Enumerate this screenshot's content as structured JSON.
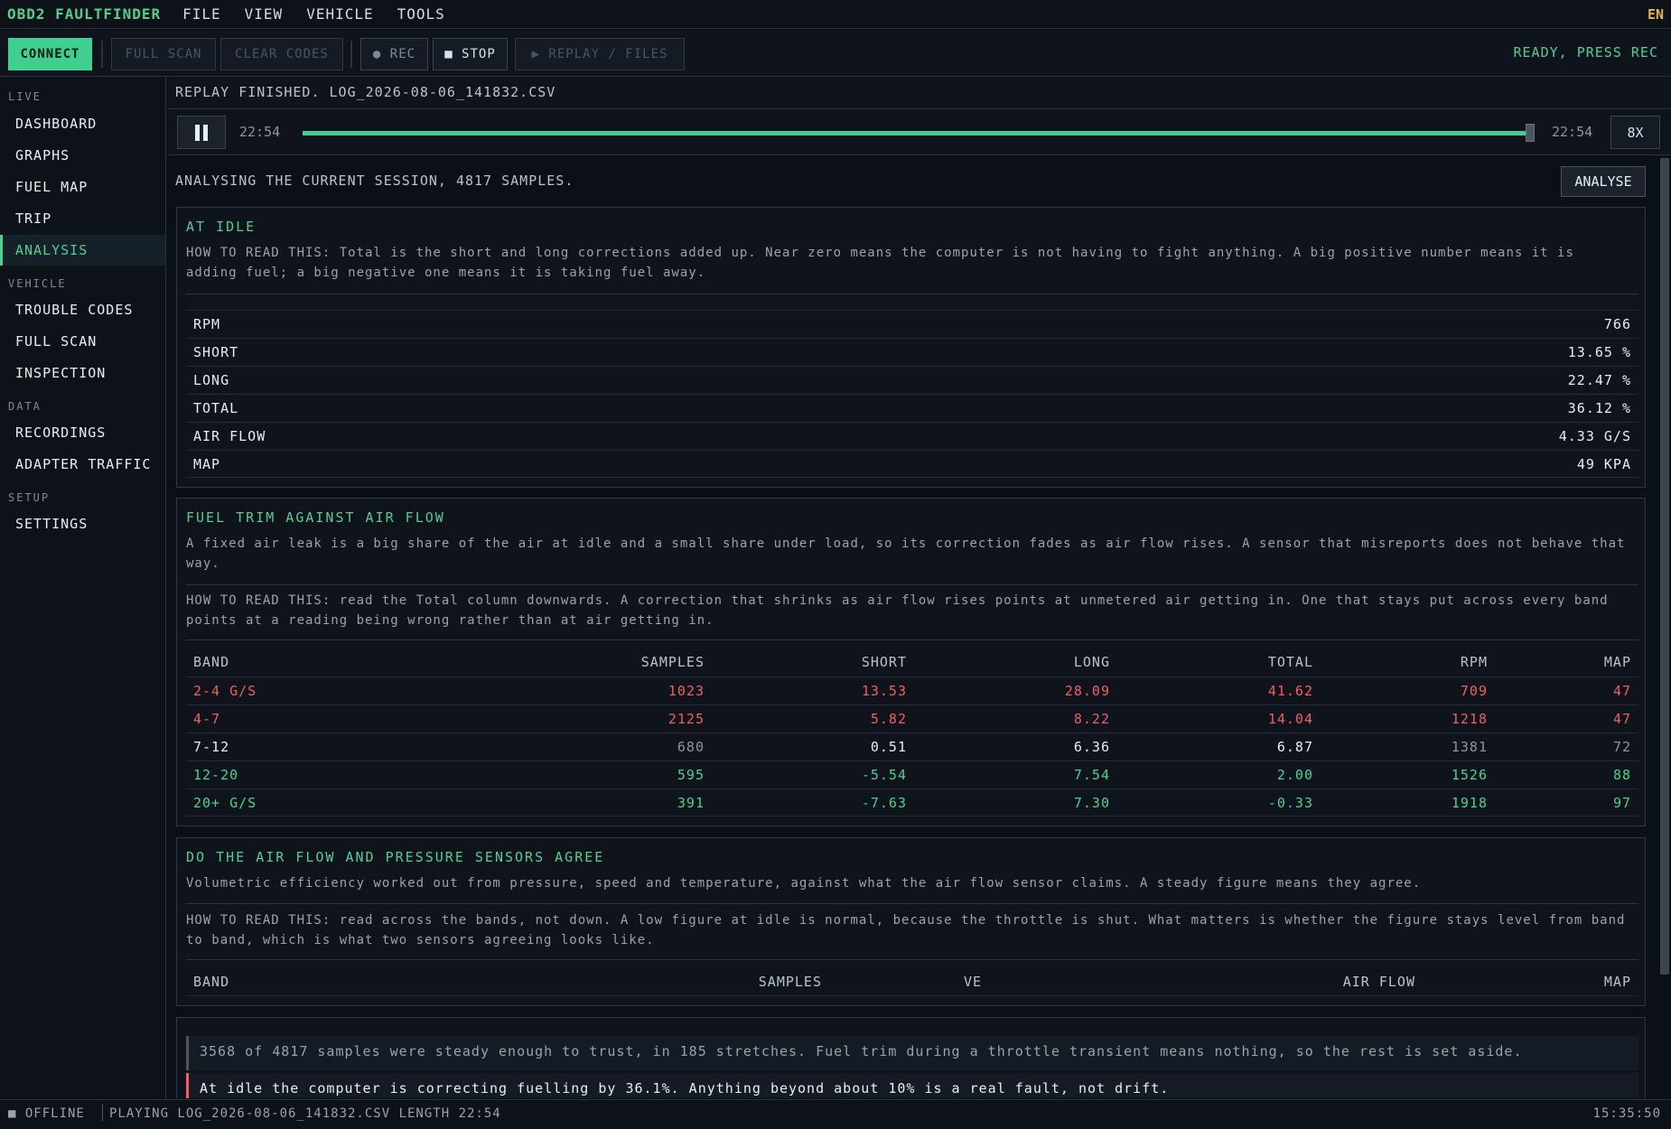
{
  "app": {
    "title": "OBD2 FAULTFINDER",
    "menus": [
      "FILE",
      "VIEW",
      "VEHICLE",
      "TOOLS"
    ],
    "lang": "EN"
  },
  "toolbar": {
    "connect": "CONNECT",
    "full_scan": "FULL SCAN",
    "clear_codes": "CLEAR CODES",
    "rec": "● REC",
    "stop": "■ STOP",
    "replay": "▶ REPLAY / FILES",
    "status": "READY, PRESS REC"
  },
  "sidebar": {
    "sections": [
      {
        "heading": "LIVE",
        "items": [
          "DASHBOARD",
          "GRAPHS",
          "FUEL MAP",
          "TRIP",
          "ANALYSIS"
        ]
      },
      {
        "heading": "VEHICLE",
        "items": [
          "TROUBLE CODES",
          "FULL SCAN",
          "INSPECTION"
        ]
      },
      {
        "heading": "DATA",
        "items": [
          "RECORDINGS",
          "ADAPTER TRAFFIC"
        ]
      },
      {
        "heading": "SETUP",
        "items": [
          "SETTINGS"
        ]
      }
    ],
    "active": "ANALYSIS"
  },
  "replay": {
    "message": "REPLAY FINISHED. LOG_2026-08-06_141832.CSV",
    "time_start": "22:54",
    "time_end": "22:54",
    "progress": 1.0,
    "speed": "8X"
  },
  "analysis": {
    "intro": "ANALYSING THE CURRENT SESSION, 4817 SAMPLES.",
    "analyse_button": "ANALYSE",
    "idle": {
      "title": "AT IDLE",
      "how": "HOW TO READ THIS: Total is the short and long corrections added up. Near zero means the computer is not having to fight anything. A big positive number means it is adding fuel; a big negative one means it is taking fuel away.",
      "rows": [
        {
          "label": "RPM",
          "value": "766"
        },
        {
          "label": "SHORT",
          "value": "13.65 %"
        },
        {
          "label": "LONG",
          "value": "22.47 %"
        },
        {
          "label": "TOTAL",
          "value": "36.12 %"
        },
        {
          "label": "AIR FLOW",
          "value": "4.33 G/S"
        },
        {
          "label": "MAP",
          "value": "49 KPA"
        }
      ]
    },
    "trim": {
      "title": "FUEL TRIM AGAINST AIR FLOW",
      "desc": "A fixed air leak is a big share of the air at idle and a small share under load, so its correction fades as air flow rises. A sensor that misreports does not behave that way.",
      "how": "HOW TO READ THIS: read the Total column downwards. A correction that shrinks as air flow rises points at unmetered air getting in. One that stays put across every band points at a reading being wrong rather than at air getting in.",
      "headers": [
        "BAND",
        "SAMPLES",
        "SHORT",
        "LONG",
        "TOTAL",
        "RPM",
        "MAP"
      ],
      "rows": [
        {
          "band": "2-4 G/S",
          "samples": "1023",
          "short": "13.53",
          "long": "28.09",
          "total": "41.62",
          "rpm": "709",
          "map": "47",
          "tone": "red"
        },
        {
          "band": "4-7",
          "samples": "2125",
          "short": "5.82",
          "long": "8.22",
          "total": "14.04",
          "rpm": "1218",
          "map": "47",
          "tone": "red"
        },
        {
          "band": "7-12",
          "samples": "680",
          "short": "0.51",
          "long": "6.36",
          "total": "6.87",
          "rpm": "1381",
          "map": "72",
          "tone": "white"
        },
        {
          "band": "12-20",
          "samples": "595",
          "short": "-5.54",
          "long": "7.54",
          "total": "2.00",
          "rpm": "1526",
          "map": "88",
          "tone": "green"
        },
        {
          "band": "20+ G/S",
          "samples": "391",
          "short": "-7.63",
          "long": "7.30",
          "total": "-0.33",
          "rpm": "1918",
          "map": "97",
          "tone": "green"
        }
      ]
    },
    "sensors": {
      "title": "DO THE AIR FLOW AND PRESSURE SENSORS AGREE",
      "desc": "Volumetric efficiency worked out from pressure, speed and temperature, against what the air flow sensor claims. A steady figure means they agree.",
      "how": "HOW TO READ THIS: read across the bands, not down. A low figure at idle is normal, because the throttle is shut. What matters is whether the figure stays level from band to band, which is what two sensors agreeing looks like.",
      "headers": [
        "BAND",
        "SAMPLES",
        "VE",
        "AIR FLOW",
        "MAP"
      ]
    },
    "notes": [
      "3568 of 4817 samples were steady enough to trust, in 185 stretches. Fuel trim during a throttle transient means nothing, so the rest is set aside.",
      "At idle the computer is correcting fuelling by 36.1%. Anything beyond about 10% is a real fault, not drift."
    ]
  },
  "statusbar": {
    "indicator": "■ OFFLINE",
    "playing": "PLAYING LOG_2026-08-06_141832.CSV LENGTH 22:54",
    "clock": "15:35:50"
  },
  "colors": {
    "accent": "#3ed08e",
    "warn": "#f06060",
    "lang": "#e8b43a"
  }
}
